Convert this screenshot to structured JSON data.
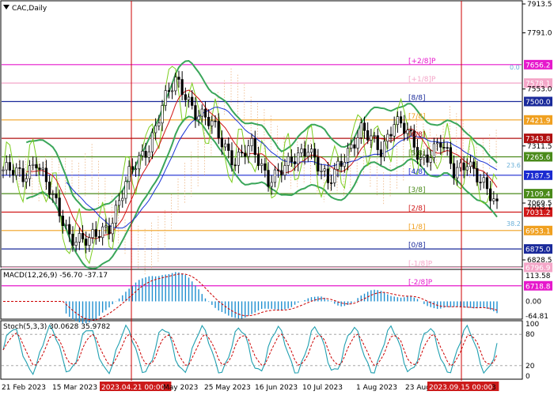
{
  "header": {
    "symbol_title": "CAC,Daily",
    "menu_icon": "triangle-down-icon"
  },
  "colors": {
    "frame": "#000000",
    "bull": "#2f9e44",
    "cursor": "#cc0000",
    "ma_blue": "#1a33d6",
    "ma_red": "#d11414",
    "bb": "#3aa65a",
    "envelope": "#7ccd1f",
    "cloud": "#e8a060",
    "macd_hist": "#1f8fd0",
    "macd_signal": "#cc0000",
    "stoch_main": "#1f9fb0",
    "stoch_signal": "#cc0000"
  },
  "price_axis_labels": [
    "7913.5",
    "7791.0",
    "7553.0",
    "7311.5",
    "7069.5",
    "6828.5"
  ],
  "murray_levels": [
    {
      "tag": "[+2/8]P",
      "price": "7656.2",
      "color": "#e619cc"
    },
    {
      "tag": "[+1/8]P",
      "price": "7578.1",
      "color": "#f4a6c8"
    },
    {
      "tag": "[8/8]",
      "price": "7500.0",
      "color": "#1a2a9a"
    },
    {
      "tag": "[7/8]",
      "price": "7421.9",
      "color": "#f0a020"
    },
    {
      "tag": "[6/8]",
      "price": "7343.8",
      "color": "#b01010"
    },
    {
      "tag": "[5/8]",
      "price": "7265.6",
      "color": "#4a8a1a"
    },
    {
      "tag": "[4/8]",
      "price": "7187.5",
      "color": "#1a2ad0"
    },
    {
      "tag": "[3/8]",
      "price": "7109.4",
      "color": "#4a8a1a"
    },
    {
      "tag": "[2/8]",
      "price": "7031.2",
      "color": "#d01818"
    },
    {
      "tag": "[1/8]",
      "price": "6953.1",
      "color": "#f0a020"
    },
    {
      "tag": "[0/8]",
      "price": "6875.0",
      "color": "#1a2a9a"
    },
    {
      "tag": "[-1/8]P",
      "price": "6796.9",
      "color": "#f4a6c8"
    },
    {
      "tag": "[-2/8]P",
      "price": "6718.8",
      "color": "#e619cc"
    }
  ],
  "current_price": "7053.1",
  "fib_labels": [
    "0.0",
    "23.6",
    "38.2"
  ],
  "macd": {
    "title": "MACD(12,26,9) -56.70 -37.17",
    "axis": [
      "113.58",
      "0.00",
      "-64.81"
    ]
  },
  "stoch": {
    "title": "Stoch(5,3,3) 30.0628 35.9782",
    "axis": [
      "100",
      "80",
      "20",
      "0"
    ]
  },
  "date_axis": [
    "21 Feb 2023",
    "15 Mar 2023",
    "2023.04.21 00:00",
    "May 2023",
    "25 May 2023",
    "16 Jun 2023",
    "10 Jul 2023",
    "1 Aug 2023",
    "23 Aug",
    "2023.09.15 00:00",
    "3"
  ],
  "cursor_dates": [
    "2023.04.21 00:00",
    "2023.09.15 00:00"
  ]
}
